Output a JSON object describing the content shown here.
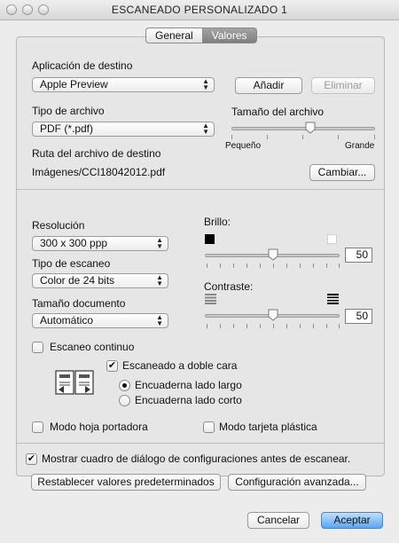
{
  "window": {
    "title": "ESCANEADO  PERSONALIZADO 1"
  },
  "tabs": [
    {
      "label": "General",
      "active": false
    },
    {
      "label": "Valores",
      "active": true
    }
  ],
  "destination": {
    "label": "Aplicación de destino",
    "selected": "Apple Preview",
    "add_button": "Añadir",
    "remove_button": "Eliminar"
  },
  "file_type": {
    "label": "Tipo de archivo",
    "selected": "PDF (*.pdf)"
  },
  "file_size": {
    "label": "Tamaño del archivo",
    "min_label": "Pequeño",
    "max_label": "Grande",
    "level": 0.55
  },
  "file_path": {
    "label": "Ruta del archivo de destino",
    "value": "Imágenes/CCI18042012.pdf",
    "change_button": "Cambiar..."
  },
  "resolution": {
    "label": "Resolución",
    "selected": "300 x 300 ppp"
  },
  "scan_type": {
    "label": "Tipo de escaneo",
    "selected": "Color de 24 bits"
  },
  "document_size": {
    "label": "Tamaño documento",
    "selected": "Automático"
  },
  "brightness": {
    "label": "Brillo:",
    "value": "50",
    "level": 0.5
  },
  "contrast": {
    "label": "Contraste:",
    "value": "50",
    "level": 0.5
  },
  "continuous_scan": {
    "label": "Escaneo continuo",
    "checked": false
  },
  "duplex": {
    "label": "Escaneado a doble cara",
    "checked": true,
    "options": [
      {
        "label": "Encuaderna lado largo",
        "selected": true
      },
      {
        "label": "Encuaderna lado corto",
        "selected": false
      }
    ]
  },
  "carrier_sheet": {
    "label": "Modo hoja portadora",
    "checked": false
  },
  "plastic_card": {
    "label": "Modo tarjeta plástica",
    "checked": false
  },
  "show_dialog": {
    "label": "Mostrar cuadro de diálogo de configuraciones antes de escanear.",
    "checked": true
  },
  "buttons": {
    "restore_defaults": "Restablecer valores predeterminados",
    "advanced": "Configuración avanzada...",
    "cancel": "Cancelar",
    "accept": "Aceptar"
  },
  "colors": {
    "accent": "#5aa6f0",
    "tab_active": "#8a8a8a"
  }
}
